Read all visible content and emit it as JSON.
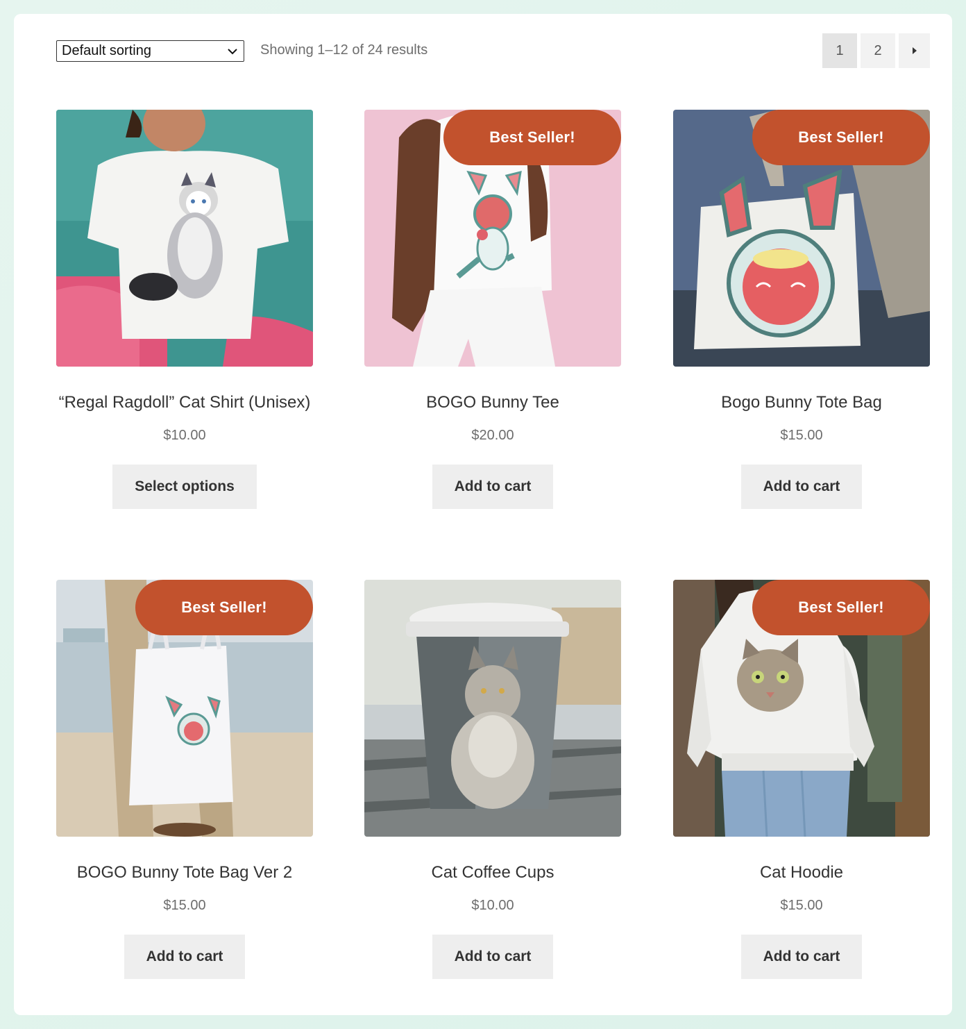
{
  "toolbar": {
    "sort_value": "Default sorting",
    "result_count": "Showing 1–12 of 24 results",
    "pages": [
      "1",
      "2"
    ],
    "current_page": "1"
  },
  "colors": {
    "badge": "#c2522d",
    "button_bg": "#eeeeee",
    "page_bg": "#ffffff",
    "backdrop": "#e2f4ec"
  },
  "products": [
    {
      "title": "“Regal Ragdoll” Cat Shirt (Unisex)",
      "price": "$10.00",
      "button": "Select options",
      "badge": ""
    },
    {
      "title": "BOGO Bunny Tee",
      "price": "$20.00",
      "button": "Add to cart",
      "badge": "Best Seller!"
    },
    {
      "title": "Bogo Bunny Tote Bag",
      "price": "$15.00",
      "button": "Add to cart",
      "badge": "Best Seller!"
    },
    {
      "title": "BOGO Bunny Tote Bag Ver 2",
      "price": "$15.00",
      "button": "Add to cart",
      "badge": "Best Seller!"
    },
    {
      "title": "Cat Coffee Cups",
      "price": "$10.00",
      "button": "Add to cart",
      "badge": ""
    },
    {
      "title": "Cat Hoodie",
      "price": "$15.00",
      "button": "Add to cart",
      "badge": "Best Seller!"
    }
  ]
}
